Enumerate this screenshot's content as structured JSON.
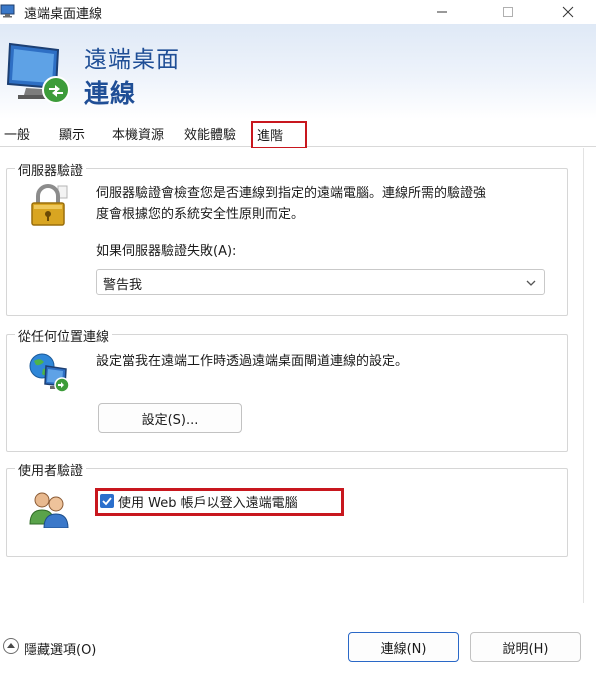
{
  "window": {
    "title": "遠端桌面連線"
  },
  "banner": {
    "line1": "遠端桌面",
    "line2": "連線"
  },
  "tabs": [
    {
      "label": "一般"
    },
    {
      "label": "顯示"
    },
    {
      "label": "本機資源"
    },
    {
      "label": "效能體驗"
    },
    {
      "label": "進階"
    }
  ],
  "server_auth": {
    "title": "伺服器驗證",
    "desc_line1": "伺服器驗證會檢查您是否連線到指定的遠端電腦。連線所需的驗證強",
    "desc_line2": "度會根據您的系統安全性原則而定。",
    "fail_label": "如果伺服器驗證失敗(A):",
    "fail_value": "警告我"
  },
  "connect_anywhere": {
    "title": "從任何位置連線",
    "desc": "設定當我在遠端工作時透過遠端桌面閘道連線的設定。",
    "settings_button": "設定(S)..."
  },
  "user_auth": {
    "title": "使用者驗證",
    "checkbox_label": "使用 Web 帳戶以登入遠端電腦",
    "checkbox_checked": true
  },
  "footer": {
    "hide_options": "隱藏選項(O)",
    "connect_button": "連線(N)",
    "help_button": "說明(H)"
  },
  "colors": {
    "accent": "#1f4e96",
    "highlight_red": "#c8171e",
    "checkbox_blue": "#2b6fcc"
  }
}
